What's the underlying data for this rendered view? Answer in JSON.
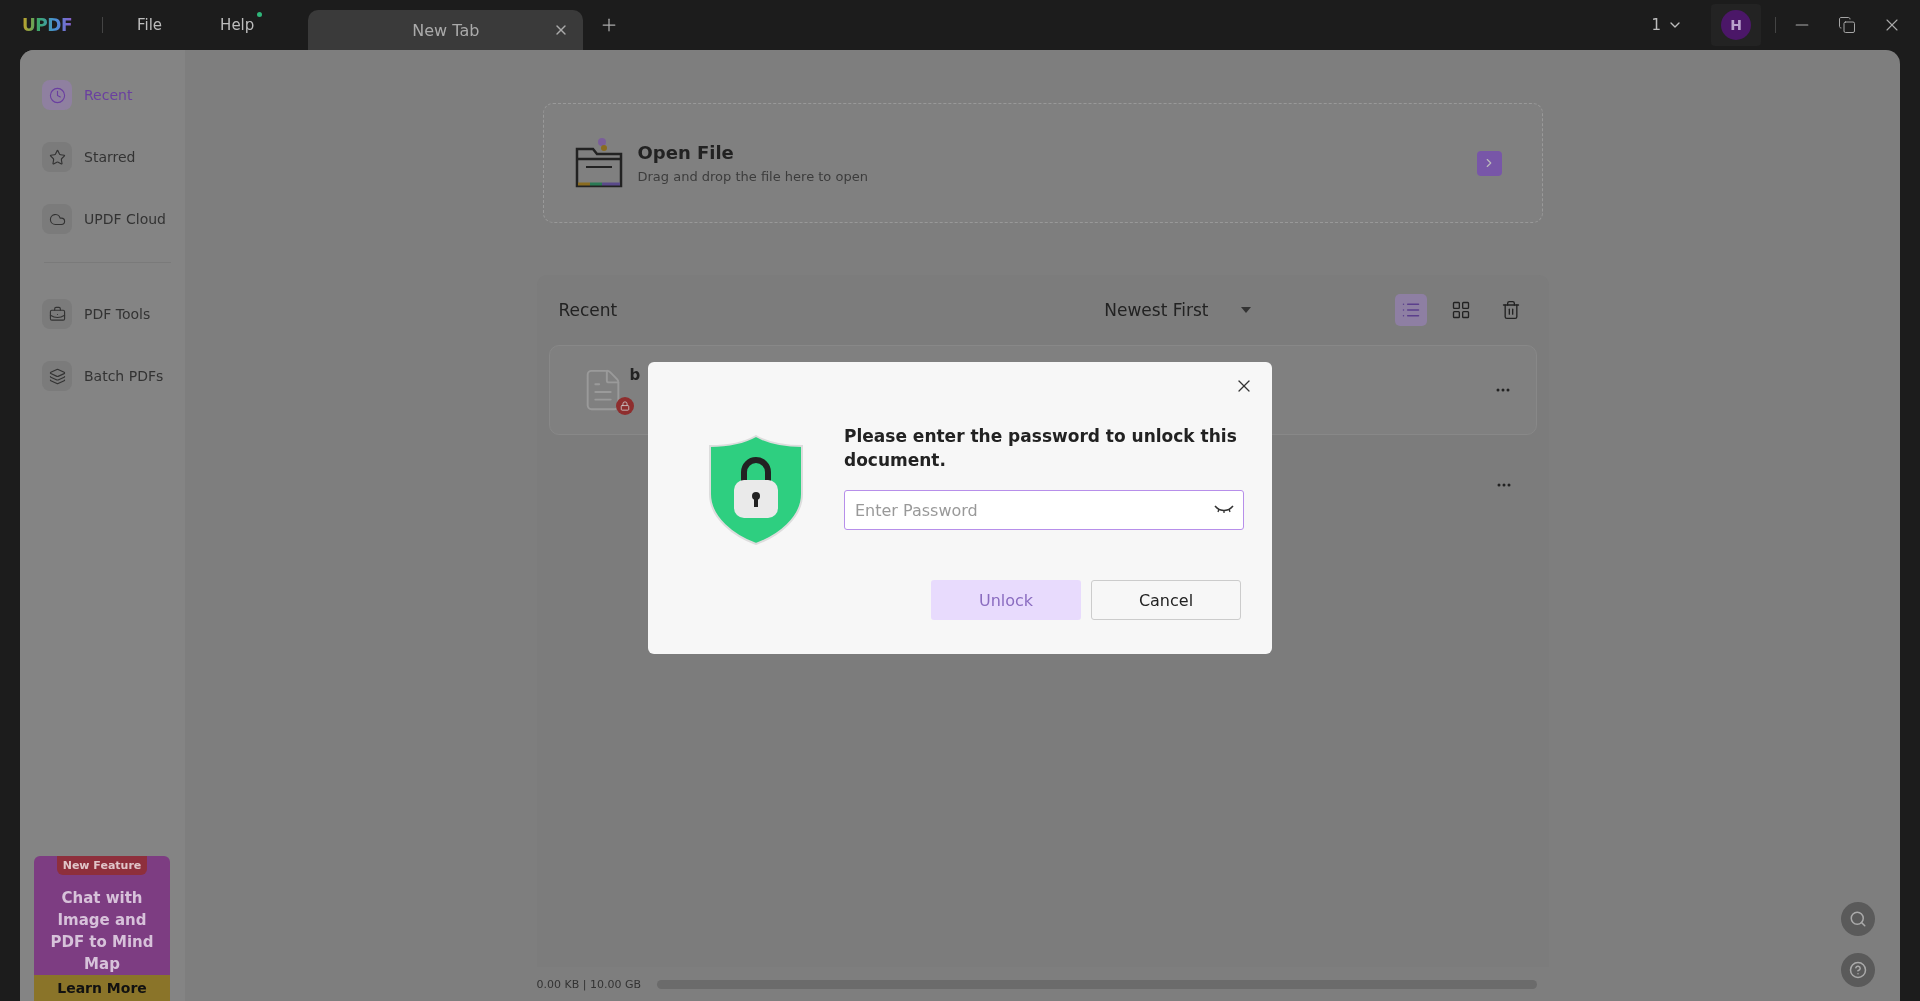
{
  "titlebar": {
    "logo": "UPDF",
    "menus": [
      {
        "label": "File",
        "dot": false
      },
      {
        "label": "Help",
        "dot": true
      }
    ],
    "tab": {
      "title": "New Tab"
    },
    "page_count": "1",
    "avatar": "H"
  },
  "sidebar": {
    "items": [
      {
        "label": "Recent",
        "selected": true
      },
      {
        "label": "Starred",
        "selected": false
      },
      {
        "label": "UPDF Cloud",
        "selected": false
      },
      {
        "label": "PDF Tools",
        "selected": false
      },
      {
        "label": "Batch PDFs",
        "selected": false
      }
    ],
    "promo": {
      "badge": "New Feature",
      "text": "Chat with Image and PDF to Mind Map",
      "button": "Learn More"
    }
  },
  "open_file": {
    "title": "Open File",
    "subtitle": "Drag and drop the file here to open"
  },
  "recent": {
    "title": "Recent",
    "sort": "Newest First",
    "views": [
      {
        "kind": "list",
        "selected": true
      },
      {
        "kind": "grid",
        "selected": false
      }
    ],
    "files": [
      {
        "kind": "document",
        "name": "b",
        "locked": true
      },
      {
        "kind": "row"
      }
    ]
  },
  "storage": {
    "text": "0.00 KB | 10.00 GB",
    "level": 0.0
  },
  "dialog": {
    "message": "Please enter the password to unlock this document.",
    "password": {
      "placeholder": "Enter Password"
    },
    "buttons": [
      {
        "label": "Unlock",
        "disabled": true
      },
      {
        "label": "Cancel",
        "disabled": false
      }
    ]
  }
}
